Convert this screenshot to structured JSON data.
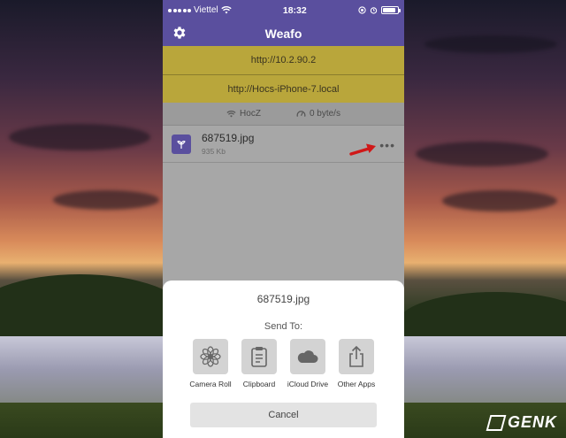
{
  "status": {
    "carrier": "Viettel",
    "time": "18:32",
    "battery_level": 0.85
  },
  "nav": {
    "title": "Weafo",
    "settings_icon": "gear-icon"
  },
  "urls": [
    "http://10.2.90.2",
    "http://Hocs-iPhone-7.local"
  ],
  "info": {
    "network": "HocZ",
    "speed": "0 byte/s"
  },
  "file": {
    "name": "687519.jpg",
    "size": "935 Kb",
    "more": "•••"
  },
  "sheet": {
    "title": "687519.jpg",
    "send_to": "Send To:",
    "apps": [
      {
        "label": "Camera Roll",
        "icon": "camera-roll-icon"
      },
      {
        "label": "Clipboard",
        "icon": "clipboard-icon"
      },
      {
        "label": "iCloud Drive",
        "icon": "icloud-icon"
      },
      {
        "label": "Other Apps",
        "icon": "share-icon"
      }
    ],
    "cancel": "Cancel"
  },
  "watermark": "GENK",
  "colors": {
    "brand": "#5a4f9e",
    "url_panel": "#b9a63b",
    "arrow": "#d01818"
  }
}
